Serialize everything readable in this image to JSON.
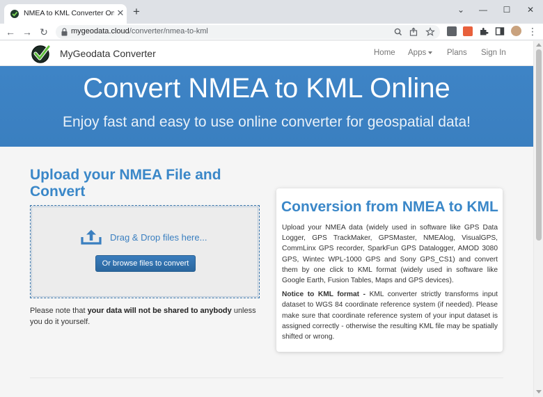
{
  "browser": {
    "tab_title": "NMEA to KML Converter Online",
    "tab_close": "✕",
    "new_tab": "+",
    "url_domain": "mygeodata.cloud",
    "url_path": "/converter/nmea-to-kml",
    "back": "←",
    "forward": "→",
    "reload": "↻",
    "minimize": "—",
    "maximize": "☐",
    "close": "✕",
    "chevron": "⌄",
    "menu": "⋮"
  },
  "navbar": {
    "brand": "MyGeodata Converter",
    "links": [
      "Home",
      "Apps",
      "Plans",
      "Sign In"
    ]
  },
  "hero": {
    "title": "Convert NMEA to KML Online",
    "subtitle": "Enjoy fast and easy to use online converter for geospatial data!"
  },
  "upload": {
    "heading": "Upload your NMEA File and Convert",
    "drag_text": "Drag & Drop files here...",
    "browse_label": "Or browse files to convert",
    "privacy_prefix": "Please note that ",
    "privacy_bold": "your data will not be shared to anybody",
    "privacy_suffix": " unless you do it yourself."
  },
  "info_card": {
    "title": "Conversion from NMEA to KML",
    "paragraph1": "Upload your NMEA data (widely used in software like GPS Data Logger, GPS TrackMaker, GPSMaster, NMEAlog, VisualGPS, CommLinx GPS recorder, SparkFun GPS Datalogger, AMOD 3080 GPS, Wintec WPL-1000 GPS and Sony GPS_CS1) and convert them by one click to KML format (widely used in software like Google Earth, Fusion Tables, Maps and GPS devices).",
    "notice_bold": "Notice to KML format -",
    "notice_text": " KML converter strictly transforms input dataset to WGS 84 coordinate reference system (if needed). Please make sure that coordinate reference system of your input dataset is assigned correctly - otherwise the resulting KML file may be spatially shifted or wrong."
  },
  "colors": {
    "hero_bg": "#3b82c4",
    "accent": "#3a87c8",
    "button": "#2e6da4"
  }
}
